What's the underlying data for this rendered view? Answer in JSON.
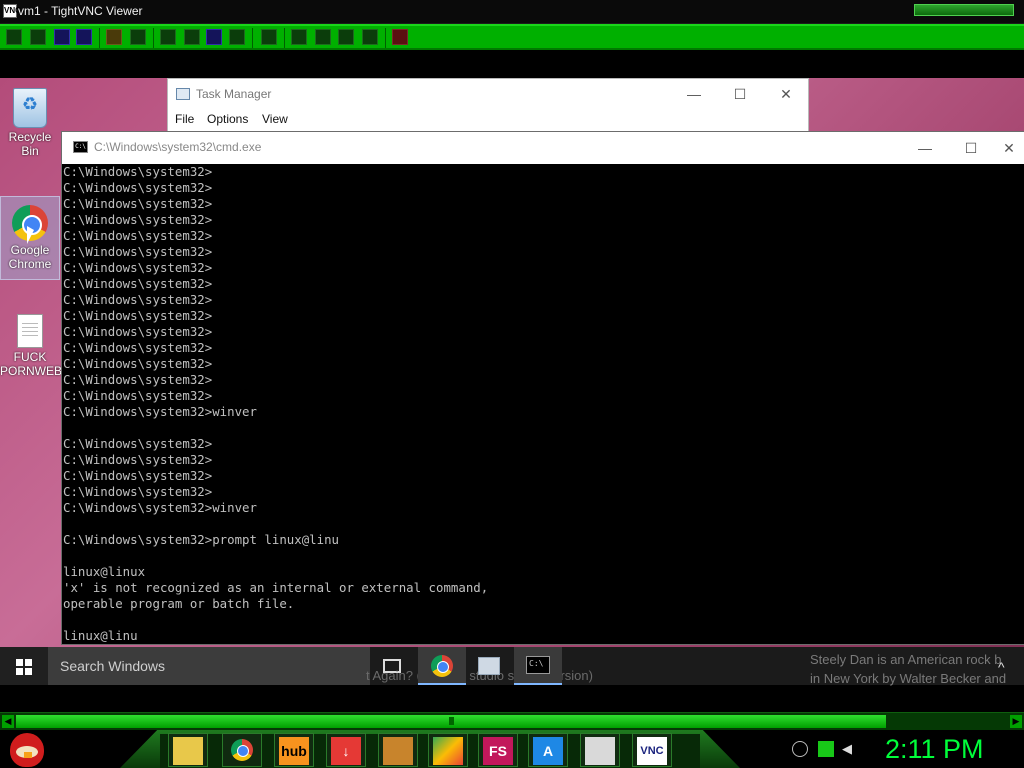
{
  "vnc": {
    "title": "vm1 - TightVNC Viewer",
    "icon_text": "VNC",
    "toolbar": {
      "buttons": [
        "new-connection-icon",
        "save-icon",
        "options-icon",
        "info-icon",
        "pause-icon",
        "refresh-icon",
        "ctrl-alt-del-icon",
        "ctrl-esc-icon",
        "ctrl-key-icon",
        "alt-key-icon",
        "file-transfer-icon",
        "scale-in-icon",
        "scale-out-icon",
        "fullscreen-icon",
        "scale-fit-icon",
        "close-icon"
      ]
    }
  },
  "desktop": {
    "icons": [
      {
        "name": "recycle-bin",
        "label": "Recycle Bin"
      },
      {
        "name": "google-chrome",
        "label": "Google Chrome"
      },
      {
        "name": "document",
        "label": "FUCK PORNWEB"
      }
    ]
  },
  "task_manager": {
    "title": "Task Manager",
    "menu": [
      "File",
      "Options",
      "View"
    ],
    "controls": {
      "minimize": "—",
      "maximize": "☐",
      "close": "✕"
    }
  },
  "cmd": {
    "title": "C:\\Windows\\system32\\cmd.exe",
    "icon_text": "C:\\",
    "controls": {
      "minimize": "—",
      "maximize": "☐",
      "close": "✕"
    },
    "lines": [
      "C:\\Windows\\system32>",
      "C:\\Windows\\system32>",
      "C:\\Windows\\system32>",
      "C:\\Windows\\system32>",
      "C:\\Windows\\system32>",
      "C:\\Windows\\system32>",
      "C:\\Windows\\system32>",
      "C:\\Windows\\system32>",
      "C:\\Windows\\system32>",
      "C:\\Windows\\system32>",
      "C:\\Windows\\system32>",
      "C:\\Windows\\system32>",
      "C:\\Windows\\system32>",
      "C:\\Windows\\system32>",
      "C:\\Windows\\system32>",
      "C:\\Windows\\system32>winver",
      "",
      "C:\\Windows\\system32>",
      "C:\\Windows\\system32>",
      "C:\\Windows\\system32>",
      "C:\\Windows\\system32>",
      "C:\\Windows\\system32>winver",
      "",
      "C:\\Windows\\system32>prompt linux@linu",
      "",
      "linux@linux",
      "'x' is not recognized as an internal or external command,",
      "operable program or batch file.",
      "",
      "linux@linu"
    ]
  },
  "taskbar": {
    "search_placeholder": "Search Windows",
    "bleed_center": "t Again? (Original studio sound version)",
    "bleed_right_1": "Steely Dan is an American rock b",
    "bleed_right_2": "in New York by Walter Becker and",
    "tray_chevron": "^"
  },
  "host": {
    "clock": "2:11 PM",
    "apps": [
      {
        "name": "folder-app",
        "label": ""
      },
      {
        "name": "chrome-app",
        "label": ""
      },
      {
        "name": "hub-app",
        "label": "hub"
      },
      {
        "name": "download-app",
        "label": ""
      },
      {
        "name": "cube-app",
        "label": ""
      },
      {
        "name": "maps-app",
        "label": ""
      },
      {
        "name": "fs-app",
        "label": "FS"
      },
      {
        "name": "a-app",
        "label": "A"
      },
      {
        "name": "snip-app",
        "label": ""
      },
      {
        "name": "vnc-app",
        "label": "VNC"
      }
    ]
  },
  "colors": {
    "vnc_green": "#00b000",
    "clock_green": "#00ff3a",
    "desktop_pink": "#c86d97",
    "cmd_text": "#c0c0c0"
  }
}
